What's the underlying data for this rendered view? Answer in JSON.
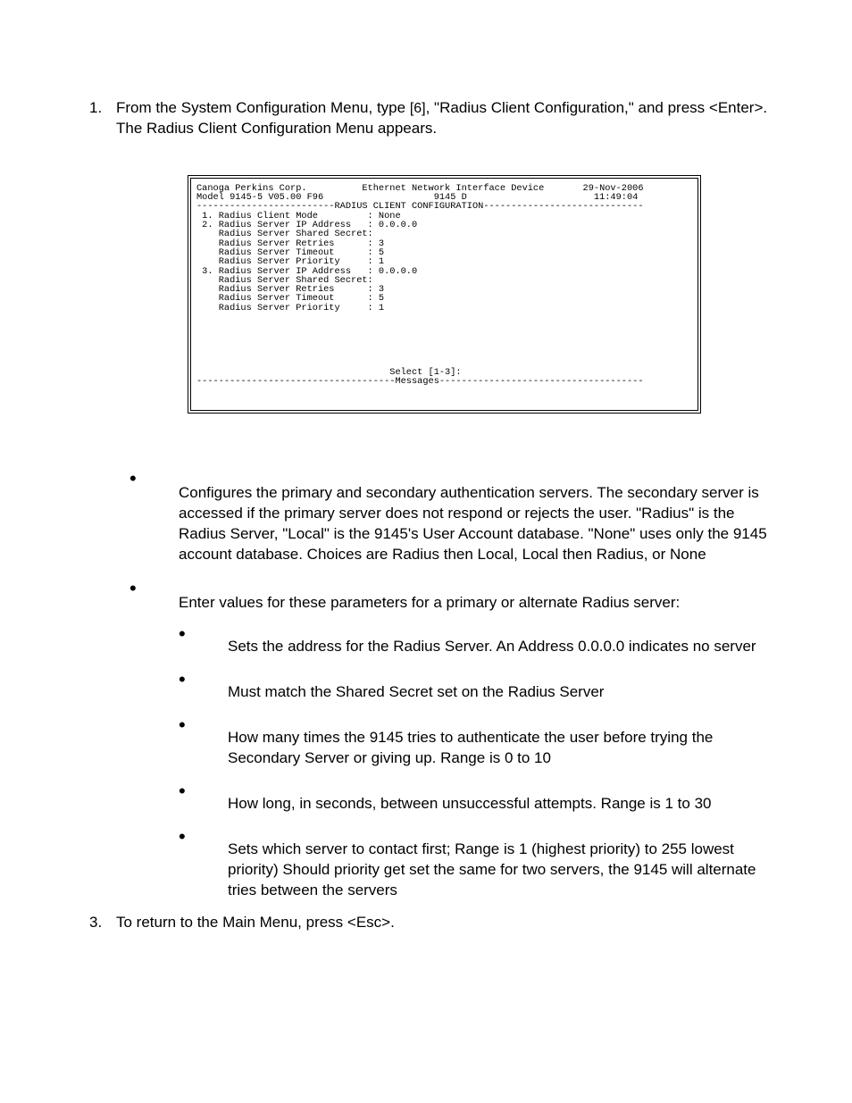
{
  "step1_num": "1.",
  "step1_text_a": "From the System Configuration Menu, type ",
  "step1_key": "[6]",
  "step1_text_b": ", \"Radius Client Configuration,\" and press <Enter>.  The Radius Client Configuration Menu appears.",
  "terminal": "Canoga Perkins Corp.          Ethernet Network Interface Device       29-Nov-2006\nModel 9145-5 V05.00 F96                    9145 D                       11:49:04\n-------------------------RADIUS CLIENT CONFIGURATION-----------------------------\n 1. Radius Client Mode         : None\n 2. Radius Server IP Address   : 0.0.0.0\n    Radius Server Shared Secret:\n    Radius Server Retries      : 3\n    Radius Server Timeout      : 5\n    Radius Server Priority     : 1\n 3. Radius Server IP Address   : 0.0.0.0\n    Radius Server Shared Secret:\n    Radius Server Retries      : 3\n    Radius Server Timeout      : 5\n    Radius Server Priority     : 1\n\n\n\n\n\n\n                                   Select [1-3]:\n------------------------------------Messages-------------------------------------\n\n",
  "bullet1": "Configures the primary and secondary authentication servers.  The secondary server is accessed if the primary server does not respond or rejects the user. \"Radius\" is the Radius Server, \"Local\" is the 9145's User Account database. \"None\" uses only the 9145 account database.  Choices are Radius then Local, Local then Radius, or None",
  "bullet2_intro": "Enter values for these parameters for a primary or alternate Radius server:",
  "sub1": "Sets the address for the Radius Server.  An Address 0.0.0.0 indicates no server",
  "sub2": "Must match the Shared Secret set on the Radius Server",
  "sub3": "How many times the 9145 tries to authenticate the user before trying the Secondary Server or giving up. Range is 0 to 10",
  "sub4": "How long, in seconds, between unsuccessful attempts. Range is 1 to 30",
  "sub5": "Sets which server to contact first; Range is 1 (highest priority) to 255 lowest priority)  Should priority get set the same for two servers, the 9145 will alternate tries between the servers",
  "step3_num": "3.",
  "step3_text": "To return to the Main Menu, press <Esc>."
}
